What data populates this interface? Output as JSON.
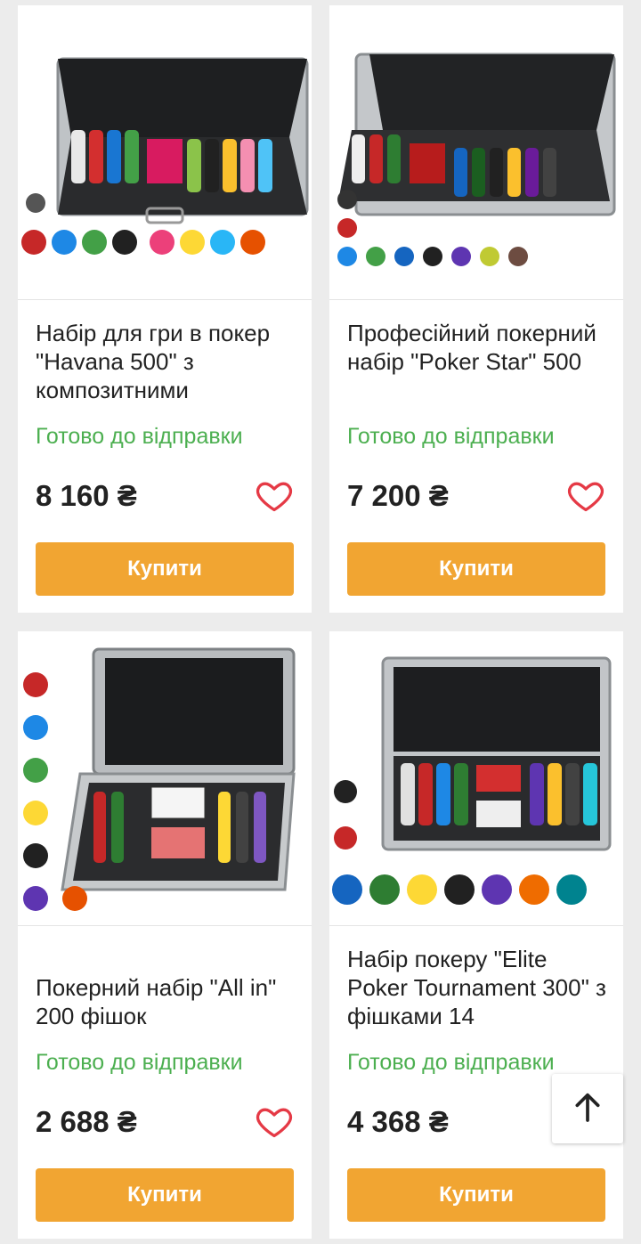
{
  "colors": {
    "accent_button": "#f1a532",
    "status_green": "#4caf50",
    "heart_red": "#e53945",
    "background": "#ececec"
  },
  "products": [
    {
      "image_alt": "Набір для гри в покер Havana 500",
      "title": "Набір для гри в покер \"Havana 500\" з композитними",
      "status": "Готово до відправки",
      "price": "8 160 ₴",
      "buy_label": "Купити",
      "icon": "heart-outline-icon"
    },
    {
      "image_alt": "Професійний покерний набір Poker Star 500",
      "title": "Професійний покерний набір \"Poker Star\" 500",
      "status": "Готово до відправки",
      "price": "7 200 ₴",
      "buy_label": "Купити",
      "icon": "heart-outline-icon"
    },
    {
      "image_alt": "Покерний набір All in 200 фішок",
      "title": "Покерний набір \"All in\" 200 фішок",
      "status": "Готово до відправки",
      "price": "2 688 ₴",
      "buy_label": "Купити",
      "icon": "heart-outline-icon"
    },
    {
      "image_alt": "Набір покеру Elite Poker Tournament 300",
      "title": "Набір покеру \"Elite Poker Tournament 300\" з фішками 14",
      "status": "Готово до відправки",
      "price": "4 368 ₴",
      "buy_label": "Купити",
      "icon": "heart-outline-icon"
    }
  ],
  "scroll_top": {
    "icon": "arrow-up-icon"
  }
}
